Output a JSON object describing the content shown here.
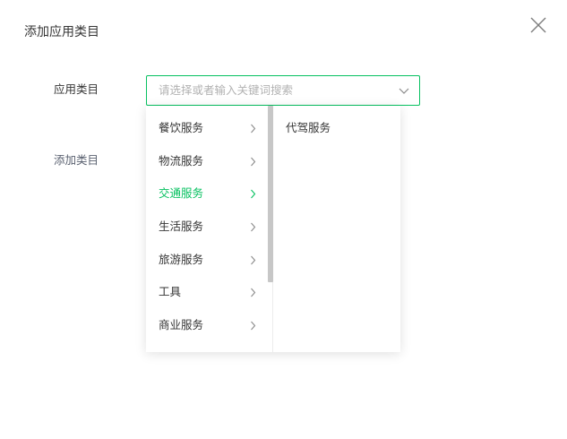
{
  "dialog": {
    "title": "添加应用类目"
  },
  "form": {
    "category_label": "应用类目",
    "add_category_label": "添加类目",
    "select_placeholder": "请选择或者输入关键词搜索",
    "select_value": ""
  },
  "dropdown": {
    "primary_options": [
      {
        "label": "餐饮服务",
        "active": false
      },
      {
        "label": "物流服务",
        "active": false
      },
      {
        "label": "交通服务",
        "active": true
      },
      {
        "label": "生活服务",
        "active": false
      },
      {
        "label": "旅游服务",
        "active": false
      },
      {
        "label": "工具",
        "active": false
      },
      {
        "label": "商业服务",
        "active": false
      }
    ],
    "secondary_options": [
      {
        "label": "代驾服务"
      }
    ]
  },
  "colors": {
    "accent": "#07c160",
    "text": "#353535",
    "placeholder": "#b2b2b2",
    "scrollbar": "#c7c7c7"
  },
  "icons": {
    "close": "close-icon",
    "select_arrow": "chevron-down-icon",
    "option_arrow": "chevron-right-icon"
  }
}
